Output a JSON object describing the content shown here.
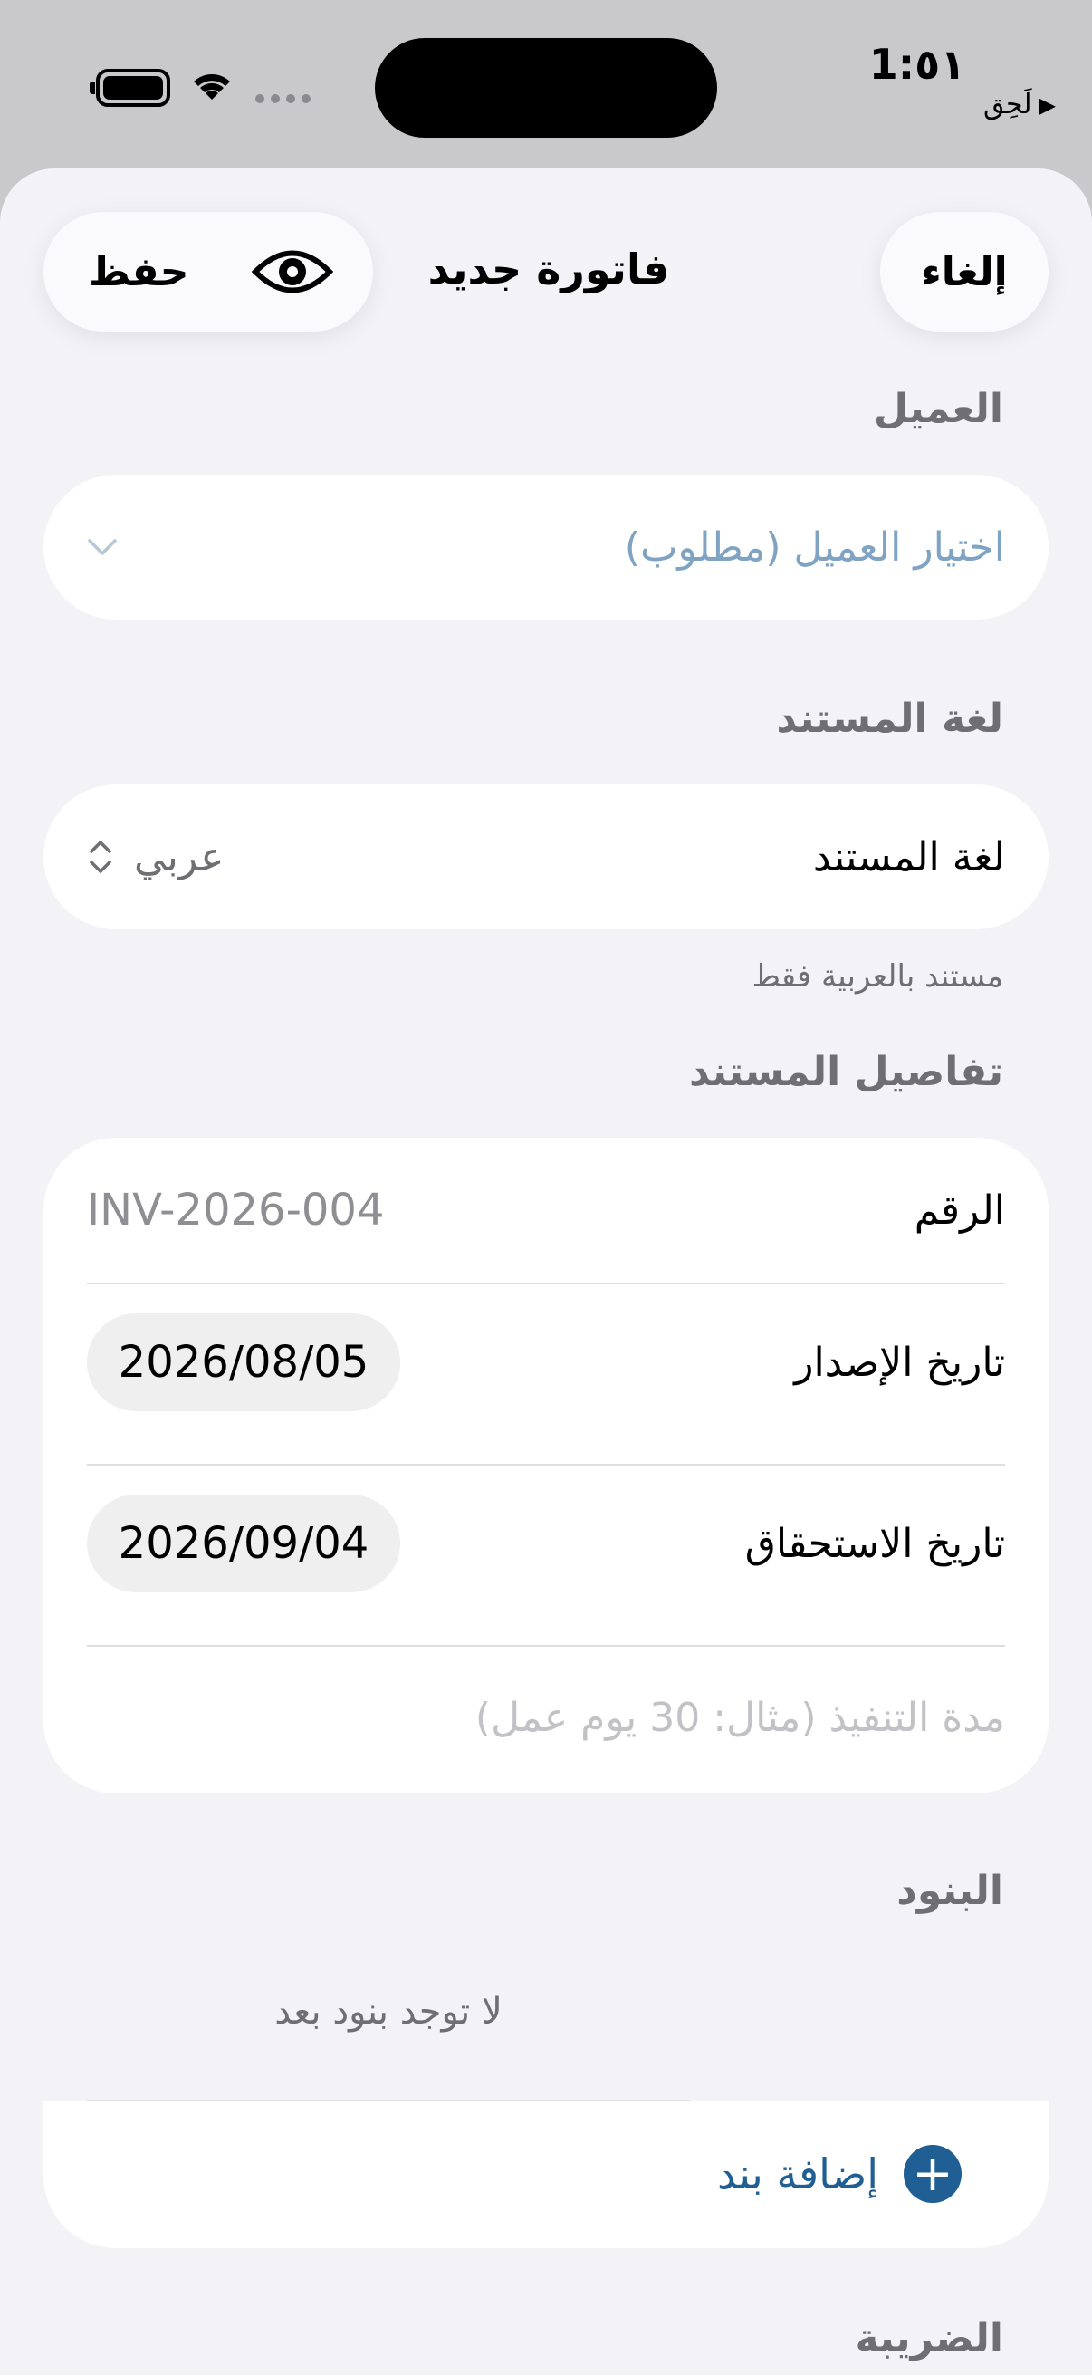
{
  "status_bar": {
    "time": "1:٥١",
    "back_label": "لَحِق",
    "back_icon": "play-triangle-icon",
    "icons": [
      "battery-icon",
      "wifi-icon",
      "cellular-signal-icon"
    ]
  },
  "nav": {
    "cancel_label": "إلغاء",
    "title": "فاتورة جديد",
    "save_label": "حفظ",
    "preview_icon": "eye-icon"
  },
  "client": {
    "section_label": "العميل",
    "placeholder": "اختيار العميل (مطلوب)",
    "chevron_icon": "chevron-down-icon"
  },
  "language": {
    "section_label": "لغة المستند",
    "row_label": "لغة المستند",
    "value": "عربي",
    "stepper_icon": "up-down-chevron-icon",
    "footnote": "مستند بالعربية فقط"
  },
  "details": {
    "section_label": "تفاصيل المستند",
    "number_label": "الرقم",
    "number_value": "INV-2026-004",
    "issue_date_label": "تاريخ الإصدار",
    "issue_date_value": "2026/08/05",
    "due_date_label": "تاريخ الاستحقاق",
    "due_date_value": "2026/09/04",
    "duration_placeholder": "مدة التنفيذ (مثال: 30 يوم عمل)"
  },
  "items": {
    "section_label": "البنود",
    "empty_text": "لا توجد بنود بعد",
    "add_label": "إضافة بند",
    "add_icon": "plus-circle-icon"
  },
  "tax": {
    "section_label": "الضريبة"
  },
  "colors": {
    "accent": "#1f5f93",
    "placeholder_blue": "#7fa3c2",
    "background": "#f2f2f7"
  }
}
